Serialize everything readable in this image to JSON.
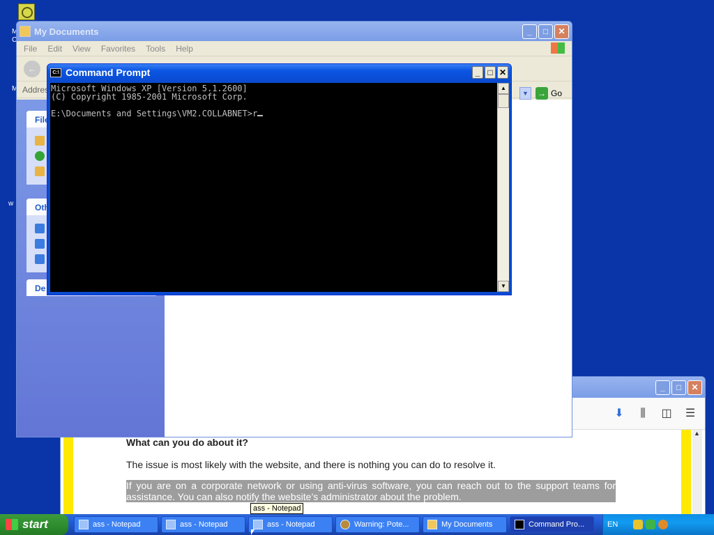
{
  "desktop": {
    "fragments": [
      "M",
      "C",
      "M",
      "w"
    ]
  },
  "firefox": {
    "heading": "What can you do about it?",
    "para1": "The issue is most likely with the website, and there is nothing you can do to resolve it.",
    "para2": "If you are on a corporate network or using anti-virus software, you can reach out to the support teams for assistance. You can also notify the website’s administrator about the problem."
  },
  "mydocs": {
    "title": "My Documents",
    "menu": [
      "File",
      "Edit",
      "View",
      "Favorites",
      "Tools",
      "Help"
    ],
    "address_label": "Addres",
    "go_label": "Go",
    "taskpane": [
      "File",
      "Oth",
      "De"
    ]
  },
  "cmd": {
    "title": "Command Prompt",
    "lines": [
      "Microsoft Windows XP [Version 5.1.2600]",
      "(C) Copyright 1985-2001 Microsoft Corp.",
      "",
      "E:\\Documents and Settings\\VM2.COLLABNET>r"
    ]
  },
  "taskbar": {
    "start_label": "start",
    "tasks": [
      {
        "label": "ass - Notepad",
        "icon": "notepad-icon"
      },
      {
        "label": "ass - Notepad",
        "icon": "notepad-icon"
      },
      {
        "label": "ass - Notepad",
        "icon": "notepad-icon"
      },
      {
        "label": "Warning: Pote...",
        "icon": "browser-icon"
      },
      {
        "label": "My Documents",
        "icon": "folder-icon"
      },
      {
        "label": "Command Pro...",
        "icon": "cmd-icon",
        "active": true
      }
    ],
    "language": "EN",
    "tooltip": "ass - Notepad"
  }
}
